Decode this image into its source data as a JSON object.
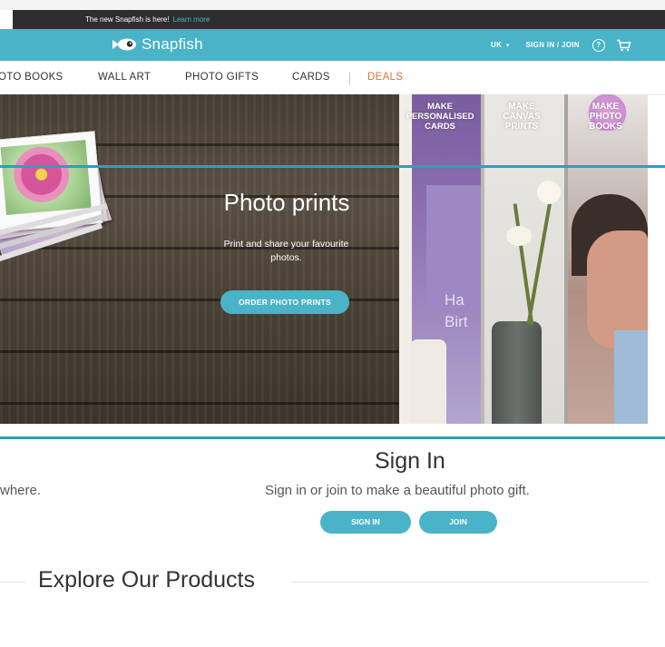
{
  "announcement": {
    "text": "The new Snapfish is here!",
    "link": "Learn more"
  },
  "header": {
    "brand": "Snapfish",
    "region": "UK",
    "region_caret": "▾",
    "signin_join": "SIGN IN / JOIN",
    "help_glyph": "?",
    "cart_glyph": "🛒",
    "bg_color": "#4ab3c7"
  },
  "nav": {
    "items": [
      {
        "label": "OTO BOOKS"
      },
      {
        "label": "WALL ART"
      },
      {
        "label": "PHOTO GIFTS"
      },
      {
        "label": "CARDS"
      },
      {
        "label": "DEALS"
      }
    ],
    "deals_color": "#e0703a"
  },
  "hero": {
    "title": "Photo prints",
    "subtitle": "Print and share your favourite photos.",
    "button": "ORDER PHOTO PRINTS"
  },
  "panels": [
    {
      "label": "MAKE PERSONALISED CARDS",
      "card_text": "Ha\nBirt"
    },
    {
      "label": "MAKE CANVAS PRINTS"
    },
    {
      "label": "MAKE PHOTO BOOKS"
    }
  ],
  "signin": {
    "title": "Sign In",
    "subtitle": "Sign in or join to make a beautiful photo gift.",
    "left_fragment": "where.",
    "signin_button": "SIGN IN",
    "join_button": "JOIN"
  },
  "explore": {
    "title": "Explore Our Products"
  },
  "icons": [
    "fish-logo-icon",
    "help-icon",
    "cart-icon",
    "caret-down-icon"
  ],
  "accent_color": "#4ab3c7",
  "rule_color": "#2aa3b7"
}
